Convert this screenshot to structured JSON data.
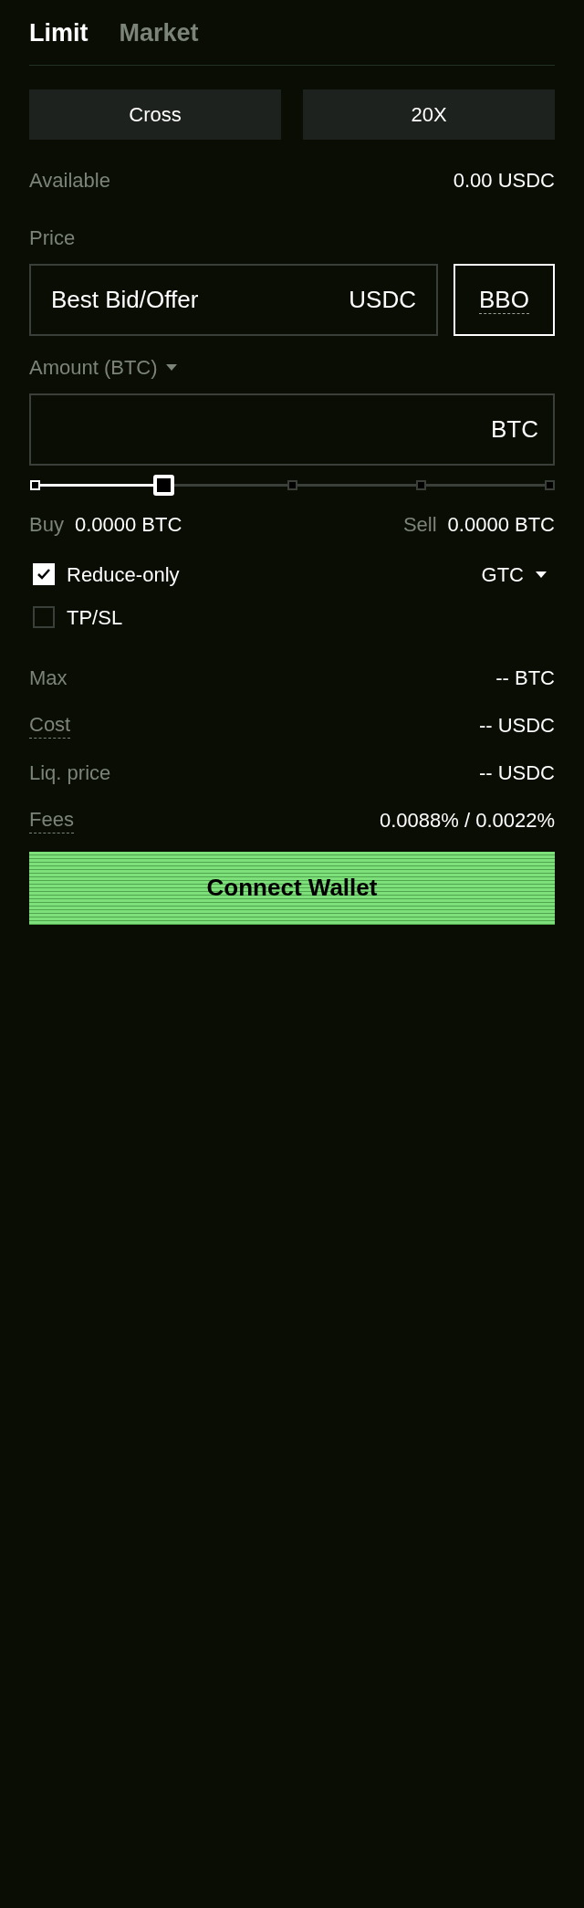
{
  "tabs": [
    {
      "label": "Limit",
      "selected": true
    },
    {
      "label": "Market",
      "selected": false
    }
  ],
  "margin_buttons": [
    "Cross",
    "20X"
  ],
  "available": {
    "label": "Available",
    "value": "0.00 USDC"
  },
  "price": {
    "label": "Price",
    "value": "Best Bid/Offer",
    "unit": "USDC",
    "bbo_button": "BBO"
  },
  "amount": {
    "label": "Amount (BTC)",
    "unit": "BTC"
  },
  "slider": {
    "level": 0.25
  },
  "buy": {
    "label": "Buy",
    "value": "0.0000 BTC"
  },
  "sell": {
    "label": "Sell",
    "value": "0.0000 BTC"
  },
  "checkboxes": [
    {
      "label": "Reduce-only",
      "checked": true
    },
    {
      "label": "TP/SL",
      "checked": false
    }
  ],
  "time_in_force": "GTC",
  "summary": [
    {
      "label": "Max",
      "value": "-- BTC",
      "dotted_underline": false
    },
    {
      "label": "Cost",
      "value": "-- USDC",
      "dotted_underline": true
    },
    {
      "label": "Liq. price",
      "value": "-- USDC",
      "dotted_underline": false
    },
    {
      "label": "Fees",
      "value": "0.0088% / 0.0022%",
      "dotted_underline": true
    }
  ],
  "connect_button": "Connect Wallet"
}
